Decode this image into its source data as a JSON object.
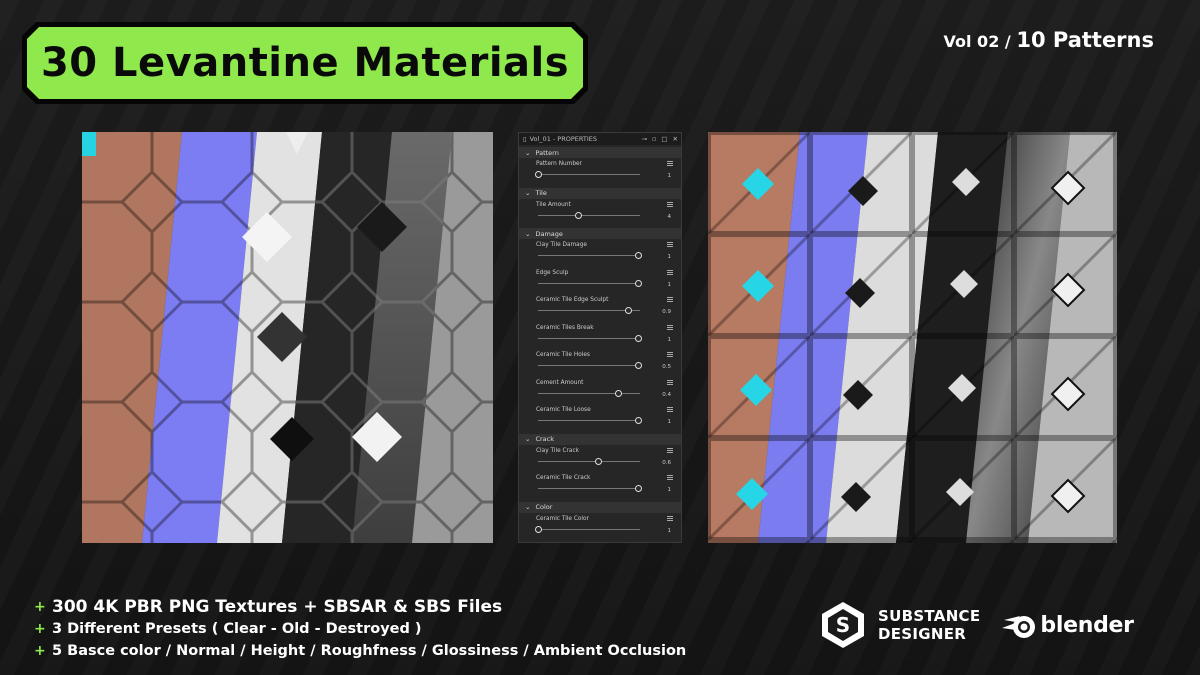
{
  "title": "30 Levantine Materials",
  "volume": {
    "vol": "Vol 02",
    "sep": "/",
    "patterns": "10 Patterns"
  },
  "properties_panel": {
    "header": "Vol_01 - PROPERTIES",
    "sections": [
      {
        "name": "Pattern",
        "params": [
          {
            "label": "Pattern Number",
            "value": "1",
            "fraction": 0.0
          }
        ]
      },
      {
        "name": "Tile",
        "params": [
          {
            "label": "Tile Amount",
            "value": "4",
            "fraction": 0.4
          }
        ]
      },
      {
        "name": "Damage",
        "params": [
          {
            "label": "Clay Tile Damage",
            "value": "1",
            "fraction": 1.0
          },
          {
            "label": "Edge Sculp",
            "value": "1",
            "fraction": 1.0
          },
          {
            "label": "Ceramic Tile Edge Sculpt",
            "value": "0.9",
            "fraction": 0.9
          },
          {
            "label": "Ceramic Tiles Break",
            "value": "1",
            "fraction": 1.0
          },
          {
            "label": "Ceramic Tile Holes",
            "value": "0.5",
            "fraction": 1.0
          },
          {
            "label": "Cement Amount",
            "value": "0.4",
            "fraction": 0.8
          },
          {
            "label": "Ceramic Tile Loose",
            "value": "1",
            "fraction": 1.0
          }
        ]
      },
      {
        "name": "Crack",
        "params": [
          {
            "label": "Clay Tile Crack",
            "value": "0.6",
            "fraction": 0.6
          },
          {
            "label": "Ceramic Tile Crack",
            "value": "1",
            "fraction": 1.0
          }
        ]
      },
      {
        "name": "Color",
        "params": [
          {
            "label": "Ceramic Tile Color",
            "value": "1",
            "fraction": 0.0
          }
        ]
      }
    ]
  },
  "features": [
    "300 4K PBR PNG Textures + SBSAR & SBS Files",
    "3 Different Presets ( Clear - Old - Destroyed )",
    "5 Basce color / Normal / Height / Roughfness / Glossiness / Ambient Occlusion"
  ],
  "logos": {
    "substance_line1": "SUBSTANCE",
    "substance_line2": "DESIGNER",
    "blender": "blender"
  },
  "colors": {
    "accent": "#8fe84c",
    "clay": "#b97a62",
    "normal": "#7b7cf0",
    "cyan": "#26d6e6"
  }
}
